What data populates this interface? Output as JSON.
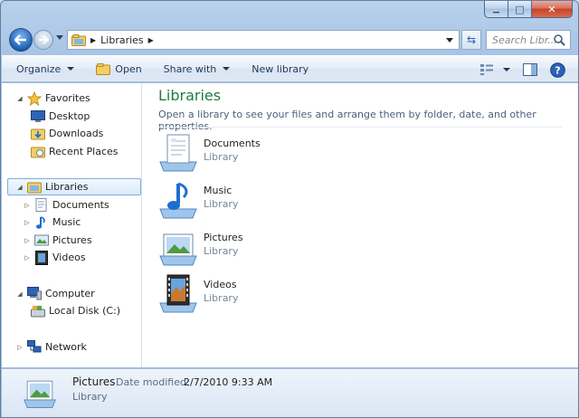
{
  "window": {
    "min_symbol": "▁",
    "max_symbol": "□",
    "close_symbol": "✕"
  },
  "navbar": {
    "breadcrumb": [
      "Libraries"
    ],
    "search_placeholder": "Search Libr..."
  },
  "toolbar": {
    "organize": "Organize",
    "open": "Open",
    "share_with": "Share with",
    "new_library": "New library"
  },
  "tree": {
    "favorites": "Favorites",
    "desktop": "Desktop",
    "downloads": "Downloads",
    "recent_places": "Recent Places",
    "libraries": "Libraries",
    "documents": "Documents",
    "music": "Music",
    "pictures": "Pictures",
    "videos": "Videos",
    "computer": "Computer",
    "local_disk": "Local Disk (C:)",
    "network": "Network"
  },
  "content": {
    "title": "Libraries",
    "subtitle": "Open a library to see your files and arrange them by folder, date, and other properties.",
    "items": [
      {
        "name": "Documents",
        "kind": "Library"
      },
      {
        "name": "Music",
        "kind": "Library"
      },
      {
        "name": "Pictures",
        "kind": "Library"
      },
      {
        "name": "Videos",
        "kind": "Library"
      }
    ]
  },
  "details": {
    "name": "Pictures",
    "modified_label": "Date modified:",
    "modified_value": "2/7/2010 9:33 AM",
    "kind": "Library"
  },
  "colors": {
    "title_green": "#1e7e3a",
    "toolbar_text": "#1e395b",
    "selection_border": "#84acdd"
  }
}
